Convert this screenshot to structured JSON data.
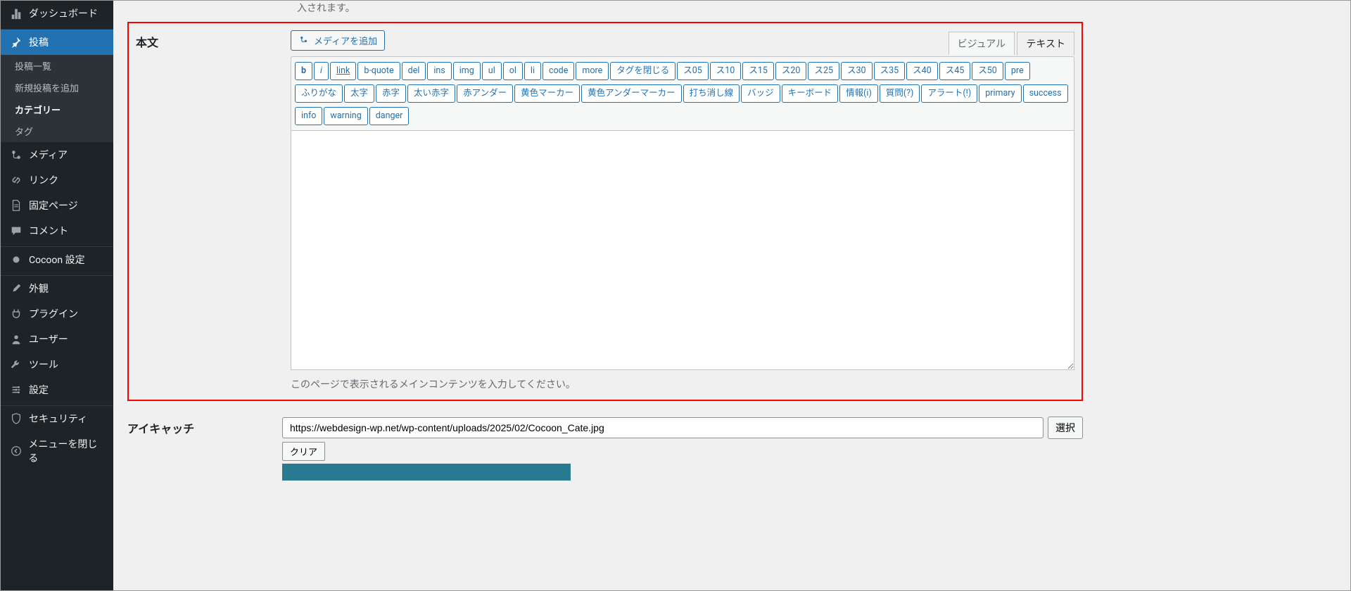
{
  "topnote": "入されます。",
  "sidebar": {
    "dashboard": "ダッシュボード",
    "posts": "投稿",
    "posts_sub": {
      "all": "投稿一覧",
      "new": "新規投稿を追加",
      "cats": "カテゴリー",
      "tags": "タグ"
    },
    "media": "メディア",
    "links": "リンク",
    "pages": "固定ページ",
    "comments": "コメント",
    "cocoon": "Cocoon 設定",
    "appearance": "外観",
    "plugins": "プラグイン",
    "users": "ユーザー",
    "tools": "ツール",
    "settings": "設定",
    "security": "セキュリティ",
    "collapse": "メニューを閉じる"
  },
  "editor": {
    "section_label": "本文",
    "add_media": "メディアを追加",
    "tab_visual": "ビジュアル",
    "tab_text": "テキスト",
    "quicktags": [
      "b",
      "i",
      "link",
      "b-quote",
      "del",
      "ins",
      "img",
      "ul",
      "ol",
      "li",
      "code",
      "more",
      "タグを閉じる",
      "ス05",
      "ス10",
      "ス15",
      "ス20",
      "ス25",
      "ス30",
      "ス35",
      "ス40",
      "ス45",
      "ス50",
      "pre",
      "ふりがな",
      "太字",
      "赤字",
      "太い赤字",
      "赤アンダー",
      "黄色マーカー",
      "黄色アンダーマーカー",
      "打ち消し線",
      "バッジ",
      "キーボード",
      "情報(i)",
      "質問(?)",
      "アラート(!)",
      "primary",
      "success",
      "info",
      "warning",
      "danger"
    ],
    "desc": "このページで表示されるメインコンテンツを入力してください。"
  },
  "eyecatch": {
    "label": "アイキャッチ",
    "url": "https://webdesign-wp.net/wp-content/uploads/2025/02/Cocoon_Cate.jpg",
    "select": "選択",
    "clear": "クリア"
  }
}
